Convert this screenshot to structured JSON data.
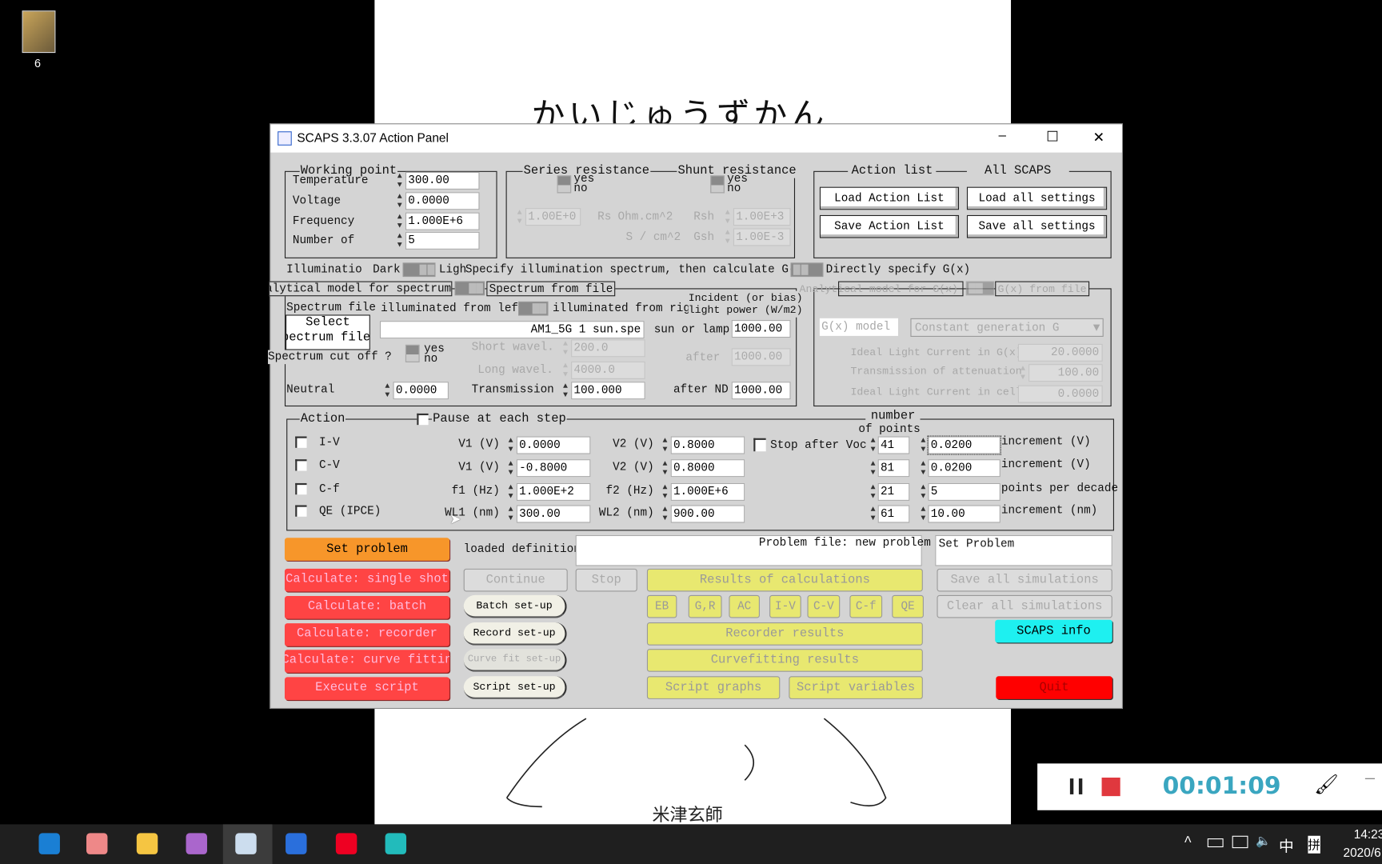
{
  "desktop": {
    "icon_label": "6",
    "page_title_handwritten": "かいじゅうずかん",
    "page_author": "米津玄師"
  },
  "window": {
    "title": "SCAPS 3.3.07 Action Panel",
    "min": "—",
    "max": "☐",
    "close": "✕"
  },
  "working_point": {
    "title": "Working point",
    "rows": [
      {
        "label": "Temperature",
        "value": "300.00"
      },
      {
        "label": "Voltage",
        "value": "0.0000"
      },
      {
        "label": "Frequency",
        "value": "1.000E+6"
      },
      {
        "label": "Number of",
        "value": "5"
      }
    ]
  },
  "resistance": {
    "series_title": "Series resistance",
    "shunt_title": "Shunt resistance",
    "yes": "yes",
    "no": "no",
    "rs_value": "1.00E+0",
    "rs_label": "Rs",
    "rs_unit": "Ohm.cm^2",
    "rsh_label": "Rsh",
    "rsh_value": "1.00E+3",
    "gsh_unit": "S / cm^2",
    "gsh_label": "Gsh",
    "gsh_value": "1.00E-3"
  },
  "action_list": {
    "title": "Action list",
    "all_title": "All SCAPS",
    "load_list": "Load Action List",
    "save_list": "Save Action List",
    "load_all": "Load all settings",
    "save_all": "Save all settings"
  },
  "illumination": {
    "label": "Illuminatio",
    "dark": "Dark",
    "light": "Ligh",
    "specify": "Specify illumination spectrum, then calculate G(x)",
    "direct": "Directly specify G(x)"
  },
  "spectrum": {
    "tab_analytical": "Analytical model for spectrum",
    "tab_file": "Spectrum from file",
    "file_label": "Spectrum file",
    "from_left": "illuminated from left",
    "from_right": "illuminated from right",
    "incident1": "Incident (or bias)",
    "incident2": "light power (W/m2)",
    "select_btn1": "Select",
    "select_btn2": "spectrum file",
    "file_value": "AM1_5G 1 sun.spe",
    "sun_lamp": "sun or lamp",
    "sun_value": "1000.00",
    "cutoff": "Spectrum cut off ?",
    "yes": "yes",
    "no": "no",
    "short_label": "Short wavel.",
    "short_value": "200.0",
    "long_label": "Long wavel.",
    "long_value": "4000.0",
    "after": "after",
    "after_value": "1000.00",
    "neutral": "Neutral",
    "neutral_value": "0.0000",
    "transmission": "Transmission",
    "transmission_value": "100.000",
    "after_nd": "after ND",
    "after_nd_value": "1000.00"
  },
  "gx": {
    "tab_analytical": "Analytical model for G(x)",
    "tab_file": "G(x) from file",
    "model_label": "G(x) model",
    "model_value": "Constant generation G",
    "ilc_label": "Ideal Light Current in G(x)",
    "ilc_value": "20.0000",
    "toa_label": "Transmission of attenuation",
    "toa_value": "100.00",
    "ilcc_label": "Ideal Light Current in cell",
    "ilcc_value": "0.0000"
  },
  "action": {
    "title": "Action",
    "pause": "Pause at each step",
    "npoints1": "number",
    "npoints2": "of points",
    "stop_voc": "Stop after Voc",
    "rows": [
      {
        "name": "I-V",
        "p1": "V1 (V)",
        "v1": "0.0000",
        "p2": "V2 (V)",
        "v2": "0.8000",
        "n": "41",
        "inc": "0.0200",
        "unit": "increment (V)"
      },
      {
        "name": "C-V",
        "p1": "V1 (V)",
        "v1": "-0.8000",
        "p2": "V2 (V)",
        "v2": "0.8000",
        "n": "81",
        "inc": "0.0200",
        "unit": "increment (V)"
      },
      {
        "name": "C-f",
        "p1": "f1 (Hz)",
        "v1": "1.000E+2",
        "p2": "f2 (Hz)",
        "v2": "1.000E+6",
        "n": "21",
        "inc": "5",
        "unit": "points per decade"
      },
      {
        "name": "QE (IPCE)",
        "p1": "WL1 (nm)",
        "v1": "300.00",
        "p2": "WL2 (nm)",
        "v2": "900.00",
        "n": "61",
        "inc": "10.00",
        "unit": "increment (nm)"
      }
    ]
  },
  "bottom": {
    "set_problem": "Set problem",
    "loaded_def": "loaded definition file:",
    "problem_file": "Problem file: new problem",
    "status": "Set Problem",
    "calc_single": "Calculate: single shot",
    "calc_batch": "Calculate: batch",
    "calc_recorder": "Calculate: recorder",
    "calc_fit": "Calculate: curve fitting",
    "exec_script": "Execute script",
    "continue": "Continue",
    "stop": "Stop",
    "batch_setup": "Batch set-up",
    "record_setup": "Record set-up",
    "fit_setup": "Curve fit set-up",
    "script_setup": "Script set-up",
    "results": "Results of calculations",
    "small": [
      "EB",
      "G,R",
      "AC",
      "I-V",
      "C-V",
      "C-f",
      "QE"
    ],
    "recorder_results": "Recorder results",
    "fit_results": "Curvefitting results",
    "script_graphs": "Script graphs",
    "script_vars": "Script variables",
    "save_sims": "Save all simulations",
    "clear_sims": "Clear all simulations",
    "info": "SCAPS info",
    "quit": "Quit"
  },
  "recorder": {
    "time": "00:01:09",
    "accent": "#3aa6c0"
  },
  "taskbar": {
    "ime_mode": "中",
    "ime": "拼",
    "time": "14:23",
    "date": "2020/6"
  }
}
